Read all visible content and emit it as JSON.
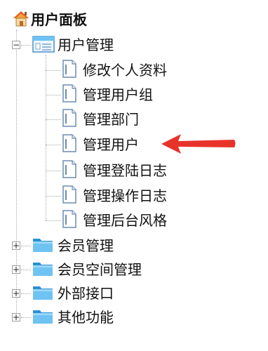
{
  "tree": {
    "root": {
      "label": "用户面板",
      "icon": "home-icon"
    },
    "user_management": {
      "label": "用户管理",
      "toggle": "−",
      "icon": "folder-open-icon",
      "children": [
        {
          "label": "修改个人资料",
          "icon": "page-icon"
        },
        {
          "label": "管理用户组",
          "icon": "page-icon"
        },
        {
          "label": "管理部门",
          "icon": "page-icon"
        },
        {
          "label": "管理用户",
          "icon": "page-icon"
        },
        {
          "label": "管理登陆日志",
          "icon": "page-icon"
        },
        {
          "label": "管理操作日志",
          "icon": "page-icon"
        },
        {
          "label": "管理后台风格",
          "icon": "page-icon"
        }
      ]
    },
    "collapsed": [
      {
        "label": "会员管理",
        "toggle": "+",
        "icon": "folder-icon"
      },
      {
        "label": "会员空间管理",
        "toggle": "+",
        "icon": "folder-icon"
      },
      {
        "label": "外部接口",
        "toggle": "+",
        "icon": "folder-icon"
      },
      {
        "label": "其他功能",
        "toggle": "+",
        "icon": "folder-icon"
      }
    ]
  },
  "annotation": {
    "color": "#e8332a",
    "icon": "red-arrow-icon"
  },
  "colors": {
    "folder": "#2a8fd6",
    "folder_light": "#6ec3f3",
    "page_border": "#6d8bb1"
  }
}
